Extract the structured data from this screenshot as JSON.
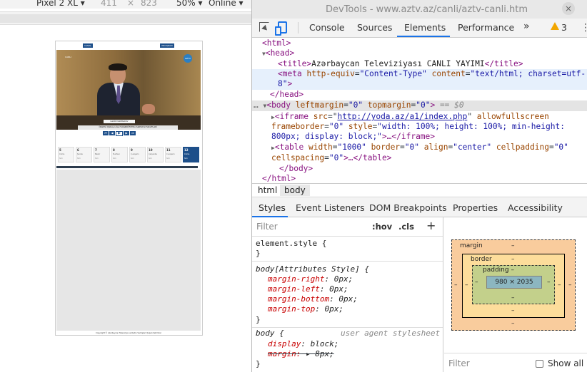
{
  "device_toolbar": {
    "device": "Pixel 2 XL",
    "width": "411",
    "times": "×",
    "height": "823",
    "zoom": "50%",
    "network": "Online"
  },
  "page": {
    "top_left_button": "CANAL",
    "top_right_button": "PROQRAM",
    "logo": "AZTV",
    "corner_tag": "CANLI",
    "name_plate": "KƏRİM MƏMMƏDOV",
    "ticker": "ÖNƏMLİ QARALƏ AİLƏ TƏSƏRRÜFATINA SƏRMAYƏ TƏKLİFLƏRİ",
    "controls": [
      "⏮",
      "◀",
      "▶",
      "▶",
      "⏭"
    ],
    "days": [
      {
        "num": "5",
        "day": "Cümə",
        "note": "Sim"
      },
      {
        "num": "6",
        "day": "Şənbə",
        "note": "Sim"
      },
      {
        "num": "7",
        "day": "Bazar",
        "note": "Sim"
      },
      {
        "num": "8",
        "day": "B.ertəsi",
        "note": "Sim"
      },
      {
        "num": "9",
        "day": "Ç.axşamı",
        "note": "Sim"
      },
      {
        "num": "10",
        "day": "Çərşənbə",
        "note": "Sim"
      },
      {
        "num": "11",
        "day": "C.axşamı",
        "note": "Sim"
      },
      {
        "num": "12",
        "day": "Cümə",
        "note": "Sim"
      }
    ],
    "copyright": "Copyright © Azərbaycan Televiziya və Radio Verilişləri Qapalı Səhmdar"
  },
  "devtools": {
    "title": "DevTools - www.aztv.az/canli/aztv-canli.htm",
    "close": "×",
    "tabs": [
      "Console",
      "Sources",
      "Elements",
      "Performance"
    ],
    "more_tabs": "»",
    "warning_count": "3",
    "menu": "⋮",
    "dom": {
      "html_open": "<html>",
      "head_open": "<head>",
      "title_open": "<title>",
      "title_text": "Azərbaycan Televiziyası CANLI YAYIMI",
      "title_close": "</title>",
      "meta_tag": "meta",
      "meta_attr1": "http-equiv",
      "meta_val1": "\"Content-Type\"",
      "meta_attr2": "content",
      "meta_val2a": "\"text/html; charset=utf-",
      "meta_val2b": "8\"",
      "meta_end": ">",
      "head_close": "</head>",
      "body_tag": "body",
      "body_attr1": "leftmargin",
      "body_val1": "\"0\"",
      "body_attr2": "topmargin",
      "body_val2": "\"0\"",
      "body_selected": "== $0",
      "iframe_tag": "iframe",
      "iframe_src_attr": "src",
      "iframe_src": "http://yoda.az/a1/index.php",
      "iframe_attr2": "allowfullscreen",
      "iframe_attr3": "frameborder",
      "iframe_val3": "\"0\"",
      "iframe_attr4": "style",
      "iframe_val4a": "\"width: 100%; height: 100%; min-height:",
      "iframe_val4b": "800px; display: block;\"",
      "iframe_end": ">…</iframe>",
      "table_tag": "table",
      "table_attrs": [
        [
          "width",
          "\"1000\""
        ],
        [
          "border",
          "\"0\""
        ],
        [
          "align",
          "\"center\""
        ],
        [
          "cellpadding",
          "\"0\""
        ]
      ],
      "table_attr5": "cellspacing",
      "table_val5": "\"0\"",
      "table_end": ">…</table>",
      "body_close": "</body>",
      "html_close": "</html>"
    },
    "breadcrumb": [
      "html",
      "body"
    ],
    "subtabs": [
      "Styles",
      "Event Listeners",
      "DOM Breakpoints",
      "Properties",
      "Accessibility"
    ],
    "styles": {
      "filter_placeholder": "Filter",
      "hov": ":hov",
      "cls": ".cls",
      "plus": "+",
      "element_style": "element.style {",
      "close_brace": "}",
      "attr_style_sel": "body[Attributes Style] {",
      "attr_props": [
        [
          "margin-right",
          "0px;"
        ],
        [
          "margin-left",
          "0px;"
        ],
        [
          "margin-bottom",
          "0px;"
        ],
        [
          "margin-top",
          "0px;"
        ]
      ],
      "ua_sel": "body {",
      "ua_origin": "user agent stylesheet",
      "ua_props": [
        [
          "display",
          "block;"
        ],
        [
          "margin:",
          "▸ 8px;"
        ]
      ]
    },
    "box_model": {
      "margin_label": "margin",
      "border_label": "border",
      "padding_label": "padding",
      "dash": "–",
      "content": "980 × 2035",
      "filter_placeholder": "Filter",
      "show_all": "Show all"
    }
  }
}
